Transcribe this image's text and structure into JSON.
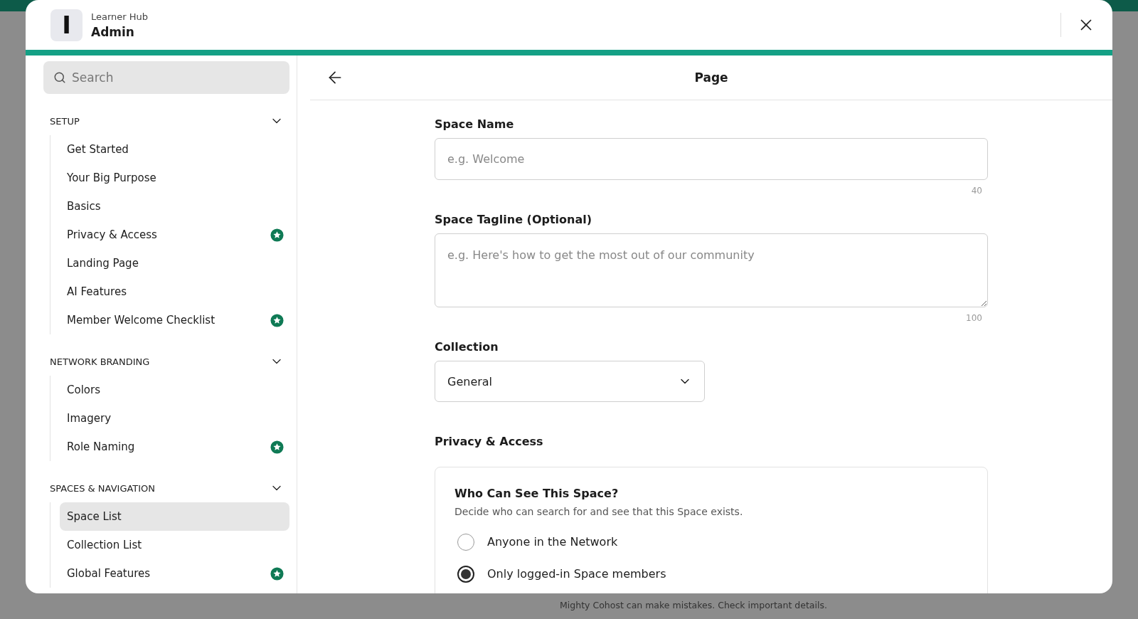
{
  "header": {
    "logo_letter": "I",
    "subtitle": "Learner Hub",
    "title": "Admin"
  },
  "sidebar": {
    "search": {
      "placeholder": "Search"
    },
    "sections": [
      {
        "title": "SETUP",
        "expanded": true,
        "items": [
          {
            "label": "Get Started",
            "starred": false,
            "selected": false
          },
          {
            "label": "Your Big Purpose",
            "starred": false,
            "selected": false
          },
          {
            "label": "Basics",
            "starred": false,
            "selected": false
          },
          {
            "label": "Privacy & Access",
            "starred": true,
            "selected": false
          },
          {
            "label": "Landing Page",
            "starred": false,
            "selected": false
          },
          {
            "label": "AI Features",
            "starred": false,
            "selected": false
          },
          {
            "label": "Member Welcome Checklist",
            "starred": true,
            "selected": false
          }
        ]
      },
      {
        "title": "NETWORK BRANDING",
        "expanded": true,
        "items": [
          {
            "label": "Colors",
            "starred": false,
            "selected": false
          },
          {
            "label": "Imagery",
            "starred": false,
            "selected": false
          },
          {
            "label": "Role Naming",
            "starred": true,
            "selected": false
          }
        ]
      },
      {
        "title": "SPACES & NAVIGATION",
        "expanded": true,
        "items": [
          {
            "label": "Space List",
            "starred": false,
            "selected": true
          },
          {
            "label": "Collection List",
            "starred": false,
            "selected": false
          },
          {
            "label": "Global Features",
            "starred": true,
            "selected": false
          }
        ]
      }
    ]
  },
  "main": {
    "title": "Page",
    "space_name": {
      "label": "Space Name",
      "placeholder": "e.g. Welcome",
      "limit": "40"
    },
    "tagline": {
      "label": "Space Tagline (Optional)",
      "placeholder": "e.g. Here's how to get the most out of our community",
      "limit": "100"
    },
    "collection": {
      "label": "Collection",
      "value": "General"
    },
    "privacy": {
      "heading": "Privacy & Access",
      "card_title": "Who Can See This Space?",
      "card_description": "Decide who can search for and see that this Space exists.",
      "options": [
        {
          "label": "Anyone in the Network",
          "selected": false
        },
        {
          "label": "Only logged-in Space members",
          "selected": true
        }
      ]
    }
  },
  "footer_note": "Mighty Cohost can make mistakes. Check important details."
}
